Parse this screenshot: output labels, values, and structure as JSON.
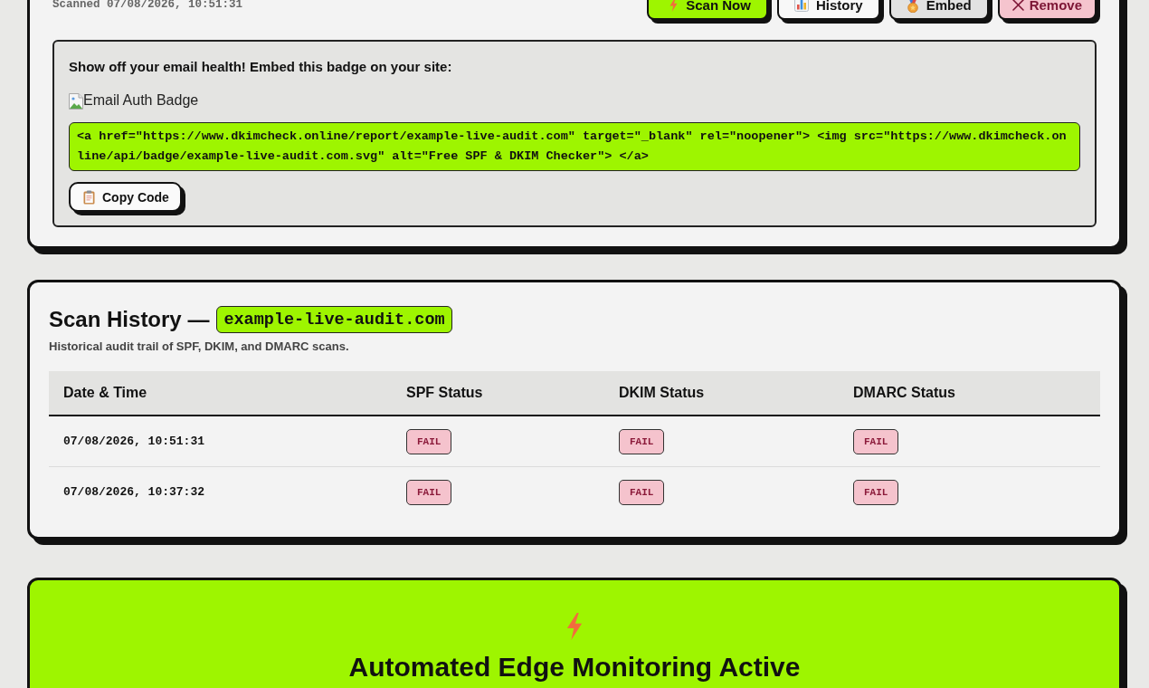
{
  "scan_panel": {
    "scanned": "Scanned 07/08/2026, 10:51:31",
    "actions": [
      {
        "label": "Scan Now",
        "kind": "scan"
      },
      {
        "label": "History",
        "kind": "history"
      },
      {
        "label": "Embed",
        "kind": "embed"
      },
      {
        "label": "Remove",
        "kind": "remove"
      }
    ],
    "embed": {
      "heading": "Show off your email health! Embed this badge on your site:",
      "badge_alt": "Email Auth Badge",
      "code": "<a href=\"https://www.dkimcheck.online/report/example-live-audit.com\" target=\"_blank\" rel=\"noopener\"> <img src=\"https://www.dkimcheck.online/api/badge/example-live-audit.com.svg\" alt=\"Free SPF & DKIM Checker\"> </a>",
      "copy_button": "Copy Code"
    }
  },
  "history": {
    "title": "Scan History —",
    "domain": "example-live-audit.com",
    "subtitle": "Historical audit trail of SPF, DKIM, and DMARC scans.",
    "columns": [
      "Date & Time",
      "SPF Status",
      "DKIM Status",
      "DMARC Status"
    ],
    "rows": [
      {
        "date": "07/08/2026, 10:51:31",
        "statuses": [
          {
            "text": "FAIL",
            "kind": "fail"
          },
          {
            "text": "FAIL",
            "kind": "fail"
          },
          {
            "text": "FAIL",
            "kind": "fail"
          }
        ]
      },
      {
        "date": "07/08/2026, 10:37:32",
        "statuses": [
          {
            "text": "FAIL",
            "kind": "fail"
          },
          {
            "text": "FAIL",
            "kind": "fail"
          },
          {
            "text": "FAIL",
            "kind": "fail"
          }
        ]
      }
    ]
  },
  "monitoring": {
    "title": "Automated Edge Monitoring Active"
  }
}
